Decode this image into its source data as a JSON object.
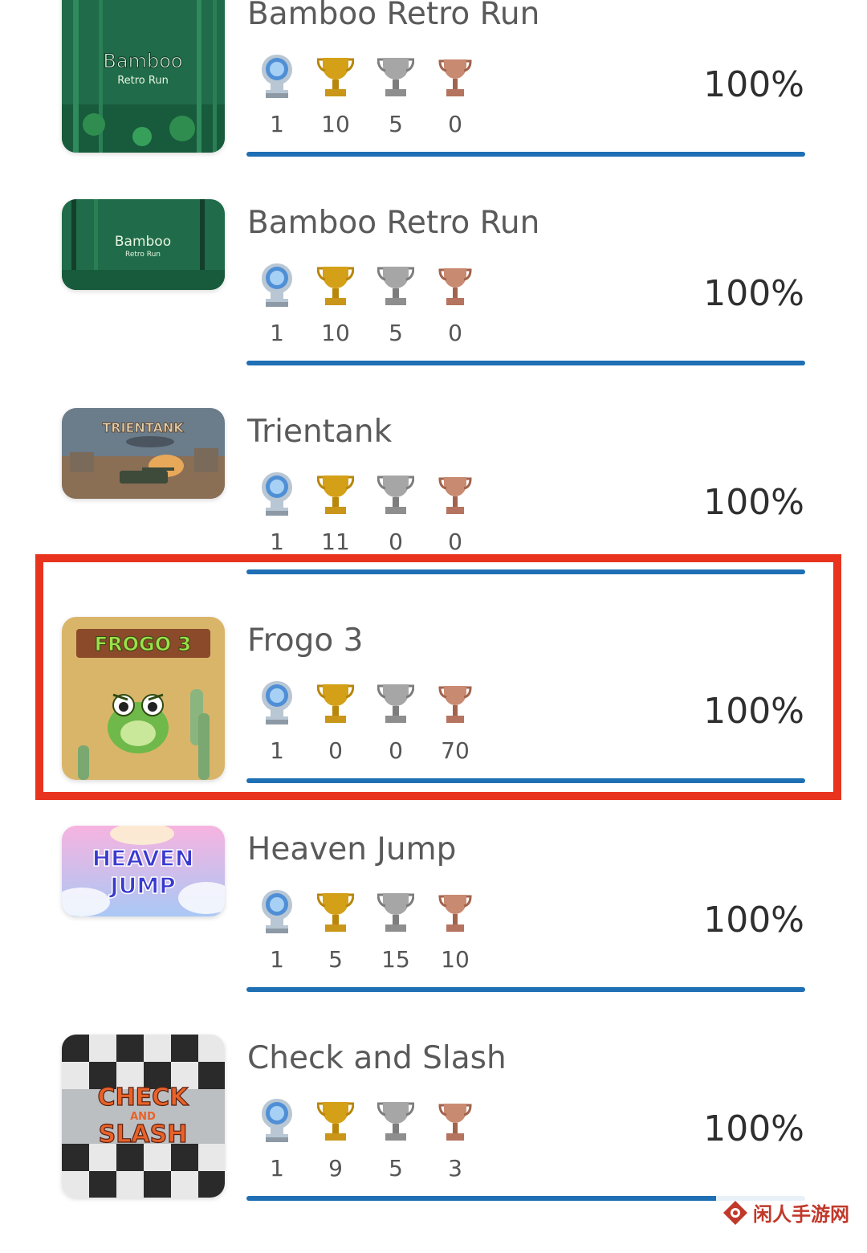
{
  "colors": {
    "progress": "#1f6fb5",
    "highlight": "#e8331f",
    "platinum": "#7fb0e0",
    "gold": "#d4a017",
    "silver": "#9a9a9a",
    "bronze": "#c07a60"
  },
  "games": [
    {
      "title": "Bamboo Retro Run",
      "cover_text": "Bamboo",
      "cover_subtext": "Retro Run",
      "platinum": "1",
      "gold": "10",
      "silver": "5",
      "bronze": "0",
      "percent": "100%",
      "progress": 1.0
    },
    {
      "title": "Bamboo Retro Run",
      "cover_text": "Bamboo",
      "cover_subtext": "Retro Run",
      "platinum": "1",
      "gold": "10",
      "silver": "5",
      "bronze": "0",
      "percent": "100%",
      "progress": 1.0
    },
    {
      "title": "Trientank",
      "cover_text": "TRIENTANK",
      "platinum": "1",
      "gold": "11",
      "silver": "0",
      "bronze": "0",
      "percent": "100%",
      "progress": 1.0
    },
    {
      "title": "Frogo 3",
      "cover_text": "FROGO 3",
      "platinum": "1",
      "gold": "0",
      "silver": "0",
      "bronze": "70",
      "percent": "100%",
      "progress": 1.0,
      "highlighted": true
    },
    {
      "title": "Heaven Jump",
      "cover_text": "HEAVEN",
      "cover_subtext": "JUMP",
      "platinum": "1",
      "gold": "5",
      "silver": "15",
      "bronze": "10",
      "percent": "100%",
      "progress": 1.0
    },
    {
      "title": "Check and Slash",
      "cover_text": "CHECK",
      "cover_mid": "AND",
      "cover_subtext": "SLASH",
      "platinum": "1",
      "gold": "9",
      "silver": "5",
      "bronze": "3",
      "percent": "100%",
      "progress": 1.0
    }
  ],
  "watermark": {
    "text": "闲人手游网",
    "icon": "diamond-logo-icon"
  }
}
